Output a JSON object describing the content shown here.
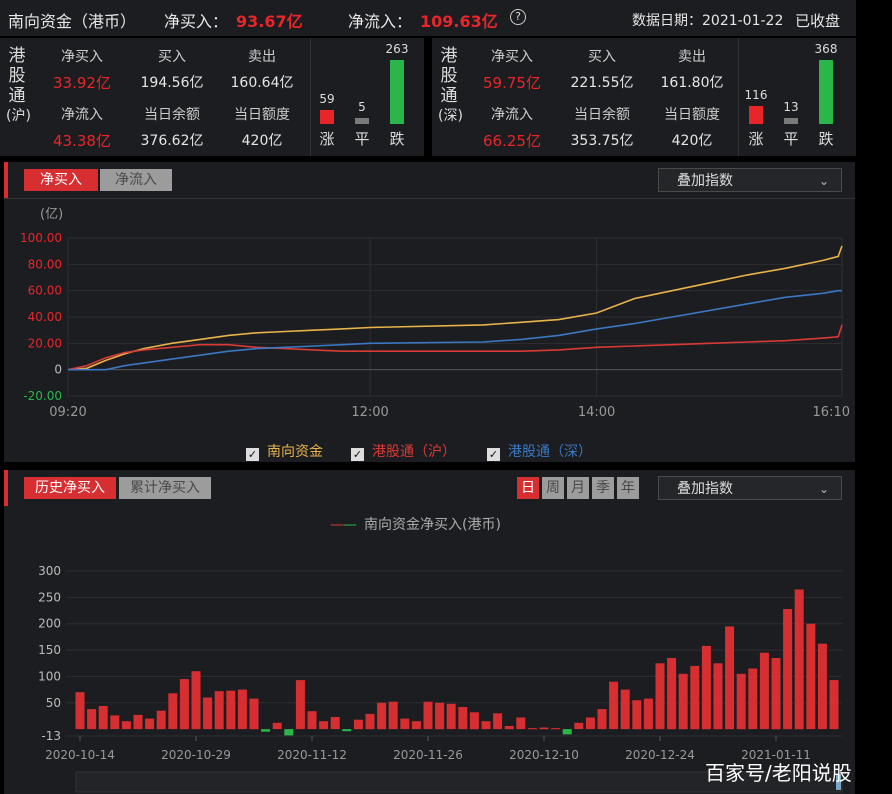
{
  "header": {
    "title": "南向资金（港币）",
    "net_buy_label": "净买入：",
    "net_buy_value": "93.67亿",
    "net_flow_label": "净流入：",
    "net_flow_value": "109.63亿",
    "help_icon": "help-circle-icon",
    "date_label": "数据日期：2021-01-22",
    "status": "已收盘"
  },
  "sh": {
    "name": [
      "港",
      "股",
      "通",
      "(沪)"
    ],
    "net_buy_label": "净买入",
    "net_buy": "33.92亿",
    "buy_label": "买入",
    "buy": "194.56亿",
    "sell_label": "卖出",
    "sell": "160.64亿",
    "net_flow_label": "净流入",
    "net_flow": "43.38亿",
    "balance_label": "当日余额",
    "balance": "376.62亿",
    "quota_label": "当日额度",
    "quota": "420亿",
    "up": "59",
    "flat": "5",
    "down": "263",
    "up_label": "涨",
    "flat_label": "平",
    "down_label": "跌"
  },
  "sz": {
    "name": [
      "港",
      "股",
      "通",
      "(深)"
    ],
    "net_buy_label": "净买入",
    "net_buy": "59.75亿",
    "buy_label": "买入",
    "buy": "221.55亿",
    "sell_label": "卖出",
    "sell": "161.80亿",
    "net_flow_label": "净流入",
    "net_flow": "66.25亿",
    "balance_label": "当日余额",
    "balance": "353.75亿",
    "quota_label": "当日额度",
    "quota": "420亿",
    "up": "116",
    "flat": "13",
    "down": "368",
    "up_label": "涨",
    "flat_label": "平",
    "down_label": "跌"
  },
  "intraday": {
    "tab_active": "净买入",
    "tab_inactive": "净流入",
    "overlay_label": "叠加指数",
    "unit": "(亿)",
    "legend": [
      "南向资金",
      "港股通（沪）",
      "港股通（深）"
    ]
  },
  "history": {
    "tab_active": "历史净买入",
    "tab_inactive": "累计净买入",
    "periods": [
      "日",
      "周",
      "月",
      "季",
      "年"
    ],
    "overlay_label": "叠加指数",
    "legend": "南向资金净买入(港币)"
  },
  "watermark": "百家号/老阳说股",
  "colors": {
    "red": "#e8262a",
    "green": "#2ab64b",
    "gold": "#e8b34a",
    "blue": "#3b77c2",
    "lred": "#d83a36"
  },
  "chart_data": [
    {
      "type": "line",
      "title": "",
      "ylabel": "(亿)",
      "x_ticks": [
        "09:20",
        "12:00",
        "14:00",
        "16:10"
      ],
      "yticks": [
        "100.00",
        "80.00",
        "60.00",
        "40.00",
        "20.00",
        "0",
        "-20.00"
      ],
      "ylim": [
        -20,
        100
      ],
      "grid": true,
      "x": [
        "09:20",
        "09:30",
        "09:40",
        "09:50",
        "10:00",
        "10:15",
        "10:30",
        "10:45",
        "11:00",
        "11:15",
        "11:30",
        "11:45",
        "12:00",
        "13:00",
        "13:20",
        "13:40",
        "14:00",
        "14:20",
        "14:40",
        "15:00",
        "15:20",
        "15:40",
        "16:00",
        "16:08",
        "16:10"
      ],
      "series": [
        {
          "name": "南向资金",
          "color": "#e8b34a",
          "values": [
            0,
            1,
            7,
            12,
            16,
            20,
            23,
            26,
            28,
            29,
            30,
            31,
            32,
            34,
            36,
            38,
            43,
            54,
            60,
            66,
            72,
            77,
            83,
            86,
            94
          ]
        },
        {
          "name": "港股通（沪）",
          "color": "#d83a36",
          "values": [
            0,
            3,
            9,
            13,
            15,
            17,
            19,
            19,
            17,
            16,
            15,
            14,
            14,
            14,
            14,
            15,
            17,
            18,
            19,
            20,
            21,
            22,
            24,
            25,
            34
          ]
        },
        {
          "name": "港股通（深）",
          "color": "#3b77c2",
          "values": [
            0,
            0,
            0,
            3,
            5,
            8,
            11,
            14,
            16,
            17,
            18,
            19,
            20,
            21,
            23,
            26,
            31,
            35,
            40,
            45,
            50,
            55,
            58,
            60,
            60
          ]
        }
      ]
    },
    {
      "type": "bar",
      "title": "",
      "legend": "南向资金净买入(港币)",
      "yticks": [
        "300",
        "250",
        "200",
        "150",
        "100",
        "50",
        "-13"
      ],
      "ylim": [
        -13,
        300
      ],
      "x_ticks": [
        "2020-10-14",
        "2020-10-29",
        "2020-11-12",
        "2020-11-26",
        "2020-12-10",
        "2020-12-24",
        "2021-01-11"
      ],
      "values": [
        70,
        38,
        44,
        26,
        15,
        27,
        20,
        35,
        68,
        95,
        110,
        60,
        72,
        73,
        75,
        58,
        -5,
        12,
        -12,
        93,
        34,
        15,
        23,
        -4,
        18,
        29,
        50,
        52,
        20,
        15,
        52,
        50,
        48,
        42,
        32,
        15,
        30,
        6,
        22,
        2,
        3,
        2,
        -10,
        12,
        22,
        38,
        90,
        75,
        55,
        58,
        125,
        135,
        105,
        120,
        158,
        125,
        195,
        105,
        115,
        145,
        135,
        228,
        265,
        200,
        162,
        93
      ]
    }
  ]
}
